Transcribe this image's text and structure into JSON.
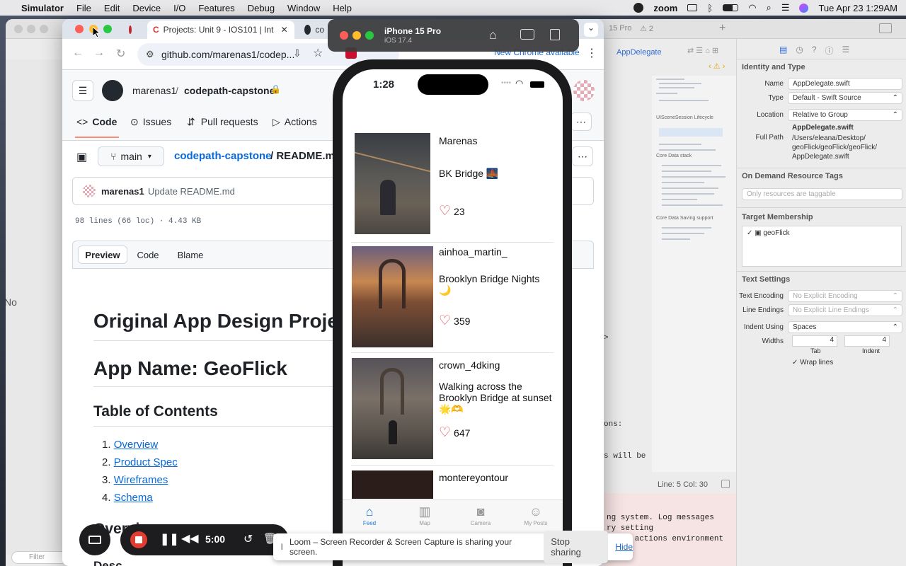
{
  "menubar": {
    "app": "Simulator",
    "items": [
      "File",
      "Edit",
      "Device",
      "I/O",
      "Features",
      "Debug",
      "Window",
      "Help"
    ],
    "zoom_label": "zoom",
    "clock": "Tue Apr 23  1:29AM"
  },
  "xcode": {
    "tab_run_label": "15 Pro",
    "tab_warning_count": "2",
    "jump_file": "AppDelegate",
    "minimap_labels": [
      "UISceneSession Lifecycle",
      "Core Data stack",
      "Core Data Saving support"
    ],
    "code_lines": [
      ">",
      "ons:",
      "s will be"
    ],
    "status": "Line: 5  Col: 30",
    "console_lines": [
      "ng system. Log messages",
      "ry setting",
      "cheme actions environment"
    ],
    "left_edge_text": "No",
    "filter_placeholder": "Filter"
  },
  "inspector": {
    "identity_title": "Identity and Type",
    "name_label": "Name",
    "name_value": "AppDelegate.swift",
    "type_label": "Type",
    "type_value": "Default - Swift Source",
    "location_label": "Location",
    "location_value": "Relative to Group",
    "location_file": "AppDelegate.swift",
    "fullpath_label": "Full Path",
    "fullpath_value": "/Users/eleana/Desktop/ geoFlick/geoFlick/geoFlick/ AppDelegate.swift",
    "odr_title": "On Demand Resource Tags",
    "odr_placeholder": "Only resources are taggable",
    "target_title": "Target Membership",
    "target_name": "geoFlick",
    "text_title": "Text Settings",
    "encoding_label": "Text Encoding",
    "encoding_value": "No Explicit Encoding",
    "line_endings_label": "Line Endings",
    "line_endings_value": "No Explicit Line Endings",
    "indent_label": "Indent Using",
    "indent_value": "Spaces",
    "widths_label": "Widths",
    "tab_width": "4",
    "indent_width": "4",
    "tab_caption": "Tab",
    "indent_caption": "Indent",
    "wrap_label": "Wrap lines"
  },
  "chrome": {
    "tabs": [
      "Projects: Unit 9 - IOS101 | Int",
      "co"
    ],
    "url": "github.com/marenas1/codep...",
    "new_chrome": "New Chrome available"
  },
  "github": {
    "owner": "marenas1",
    "repo": "codepath-capstone",
    "nav": [
      "Code",
      "Issues",
      "Pull requests",
      "Actions"
    ],
    "branch": "main",
    "breadcrumb_repo": "codepath-capstone",
    "breadcrumb_file": "README.m",
    "commit_author": "marenas1",
    "commit_message": "Update README.md",
    "file_meta": "98 lines (66 loc) · 4.43 KB",
    "view_tabs": [
      "Preview",
      "Code",
      "Blame"
    ],
    "h1_title": "Original App Design Projec",
    "h1_app": "App Name: GeoFlick",
    "toc_title": "Table of Contents",
    "toc": [
      "Overview",
      "Product Spec",
      "Wireframes",
      "Schema"
    ],
    "overview": "Overview",
    "desc_partial": "Desc"
  },
  "simulator": {
    "device": "iPhone 15 Pro",
    "os": "iOS 17.4"
  },
  "phone": {
    "time": "1:28",
    "posts": [
      {
        "user": "Marenas",
        "caption": "BK Bridge 🌉",
        "likes": "23"
      },
      {
        "user": "ainhoa_martin_",
        "caption": "Brooklyn Bridge Nights 🌙",
        "likes": "359"
      },
      {
        "user": "crown_4dking",
        "caption": "Walking across the Brooklyn Bridge at sunset 🌟🫶",
        "likes": "647"
      },
      {
        "user": "montereyontour",
        "caption": "",
        "likes": ""
      }
    ],
    "tabs": [
      "Feed",
      "Map",
      "Camera",
      "My Posts"
    ],
    "accent": "#1f77d4"
  },
  "loom": {
    "timer": "5:00",
    "message": "Loom – Screen Recorder & Screen Capture is sharing your screen.",
    "stop": "Stop sharing",
    "hide": "Hide"
  }
}
